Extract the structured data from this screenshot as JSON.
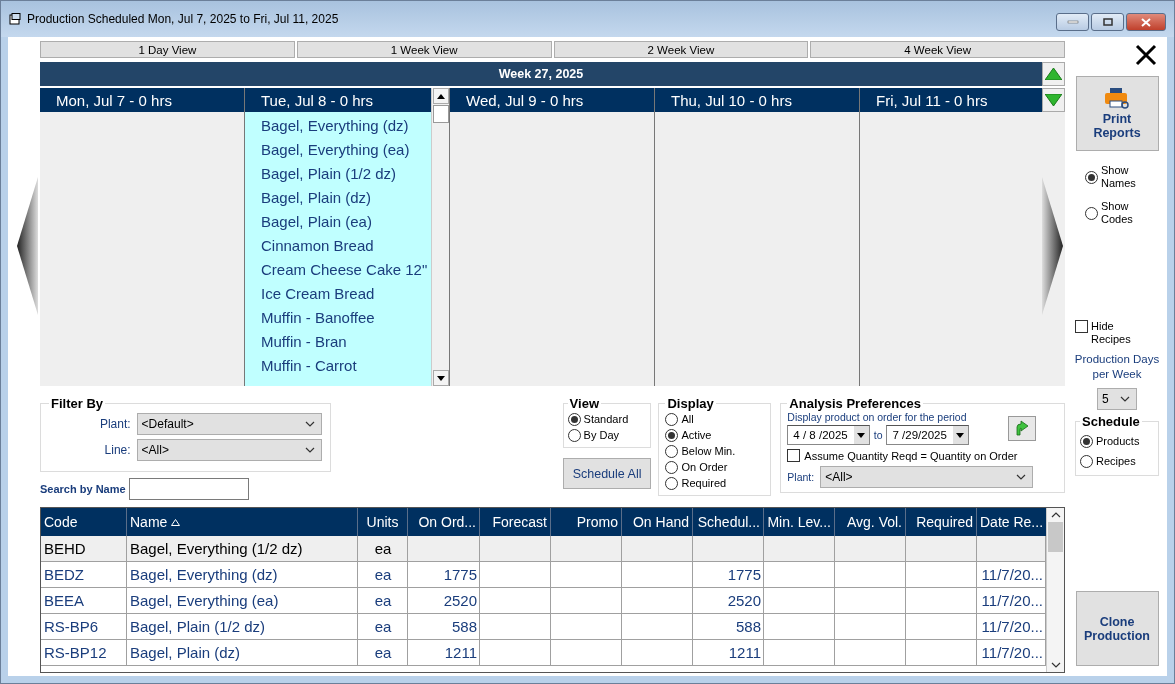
{
  "window": {
    "title": "Production Scheduled Mon, Jul 7, 2025 to Fri, Jul 11, 2025"
  },
  "view_buttons": [
    "1 Day View",
    "1 Week View",
    "2 Week View",
    "4 Week View"
  ],
  "week": {
    "title": "Week 27, 2025"
  },
  "days": [
    {
      "label": "Mon, Jul 7 - 0 hrs",
      "selected": false
    },
    {
      "label": "Tue, Jul 8 - 0 hrs",
      "selected": true,
      "items": [
        "Bagel, Everything (dz)",
        "Bagel, Everything (ea)",
        "Bagel, Plain (1/2 dz)",
        "Bagel, Plain (dz)",
        "Bagel, Plain (ea)",
        "Cinnamon Bread",
        "Cream Cheese Cake 12\"",
        "Ice Cream Bread",
        "Muffin - Banoffee",
        "Muffin - Bran",
        "Muffin - Carrot"
      ]
    },
    {
      "label": "Wed, Jul 9 - 0 hrs",
      "selected": false
    },
    {
      "label": "Thu, Jul 10 - 0 hrs",
      "selected": false
    },
    {
      "label": "Fri, Jul 11 - 0 hrs",
      "selected": false
    }
  ],
  "filter": {
    "title": "Filter By",
    "fields": [
      {
        "label": "Plant:",
        "value": "<Default>"
      },
      {
        "label": "Line:",
        "value": "<All>"
      }
    ]
  },
  "search": {
    "label": "Search by Name"
  },
  "view_group": {
    "title": "View",
    "options": [
      {
        "label": "Standard",
        "selected": true
      },
      {
        "label": "By Day",
        "selected": false
      }
    ]
  },
  "schedule_all_button": "Schedule All",
  "display_group": {
    "title": "Display",
    "options": [
      {
        "label": "All",
        "selected": false
      },
      {
        "label": "Active",
        "selected": true
      },
      {
        "label": "Below Min.",
        "selected": false
      },
      {
        "label": "On Order",
        "selected": false
      },
      {
        "label": "Required",
        "selected": false
      }
    ]
  },
  "analysis": {
    "title": "Analysis Preferences",
    "period_label": "Display product on order for the period",
    "from_date": "4 / 8 /2025",
    "to_label": "to",
    "to_date": "7 /29/2025",
    "assume": {
      "label": "Assume Quantity Reqd = Quantity on Order",
      "checked": false
    },
    "plant": {
      "label": "Plant:",
      "value": "<All>"
    }
  },
  "table": {
    "columns": [
      {
        "label": "Code",
        "sorted": false
      },
      {
        "label": "Name",
        "sorted": true
      },
      {
        "label": "Units",
        "sorted": false
      },
      {
        "label": "On Ord...",
        "sorted": false
      },
      {
        "label": "Forecast",
        "sorted": false
      },
      {
        "label": "Promo",
        "sorted": false
      },
      {
        "label": "On Hand",
        "sorted": false
      },
      {
        "label": "Schedul...",
        "sorted": false
      },
      {
        "label": "Min. Lev...",
        "sorted": false
      },
      {
        "label": "Avg. Vol.",
        "sorted": false
      },
      {
        "label": "Required",
        "sorted": false
      },
      {
        "label": "Date Re...",
        "sorted": false
      }
    ],
    "rows": [
      {
        "selected": true,
        "cells": {
          "code": "BEHD",
          "name": "Bagel, Everything (1/2 dz)",
          "units": "ea"
        }
      },
      {
        "selected": false,
        "cells": {
          "code": "BEDZ",
          "name": "Bagel, Everything (dz)",
          "units": "ea",
          "on_order": "1775",
          "scheduled": "1775",
          "date_req": "11/7/20..."
        }
      },
      {
        "selected": false,
        "cells": {
          "code": "BEEA",
          "name": "Bagel, Everything (ea)",
          "units": "ea",
          "on_order": "2520",
          "scheduled": "2520",
          "date_req": "11/7/20..."
        }
      },
      {
        "selected": false,
        "cells": {
          "code": "RS-BP6",
          "name": "Bagel, Plain (1/2 dz)",
          "units": "ea",
          "on_order": "588",
          "scheduled": "588",
          "date_req": "11/7/20..."
        }
      },
      {
        "selected": false,
        "cells": {
          "code": "RS-BP12",
          "name": "Bagel, Plain (dz)",
          "units": "ea",
          "on_order": "1211",
          "scheduled": "1211",
          "date_req": "11/7/20..."
        }
      }
    ]
  },
  "side": {
    "print_button": "Print Reports",
    "name_options": [
      {
        "label": "Show Names",
        "selected": true
      },
      {
        "label": "Show Codes",
        "selected": false
      }
    ],
    "hide_recipes": {
      "label": "Hide Recipes",
      "checked": false
    },
    "days_label": "Production Days per Week",
    "days_value": "5",
    "schedule": {
      "title": "Schedule",
      "options": [
        {
          "label": "Products",
          "selected": true
        },
        {
          "label": "Recipes",
          "selected": false
        }
      ]
    },
    "clone_button": "Clone Production"
  }
}
